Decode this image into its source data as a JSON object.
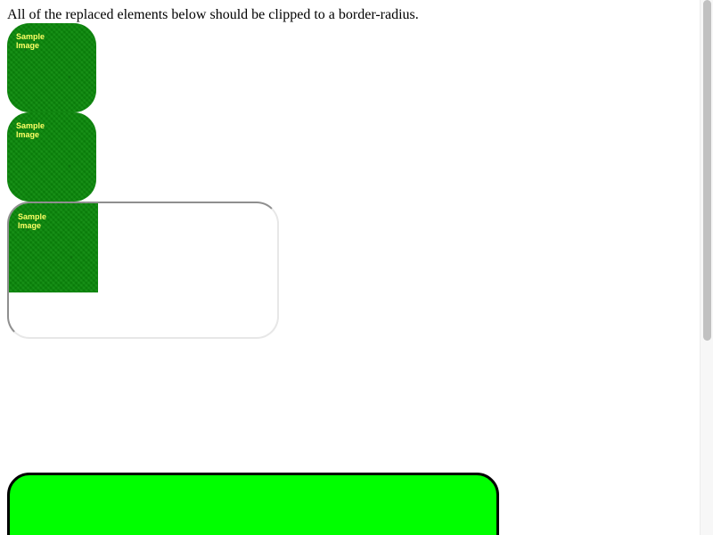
{
  "page": {
    "intro_text": "All of the replaced elements below should be clipped to a border-radius."
  },
  "images": [
    {
      "caption": "Sample\nImage"
    },
    {
      "caption": "Sample\nImage"
    },
    {
      "caption": "Sample\nImage"
    }
  ],
  "colors": {
    "image_green": "#0b8a0b",
    "caption_yellow": "#ffff66",
    "box_green": "#00ff00",
    "box_border": "#000000",
    "scrollbar_thumb": "#c1c1c1"
  },
  "scroll": {
    "thumb_fraction": 0.64
  }
}
